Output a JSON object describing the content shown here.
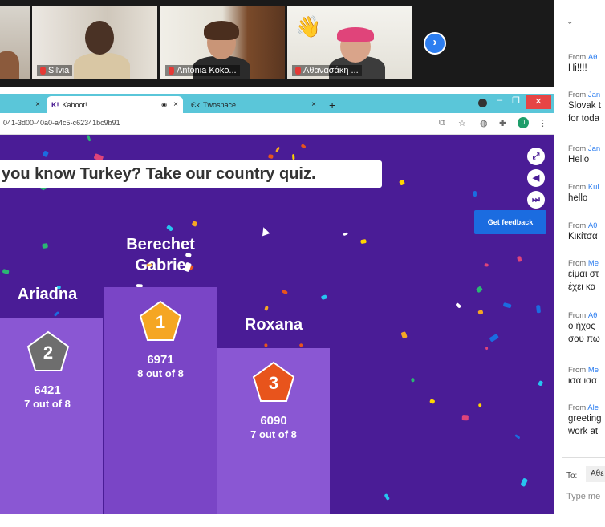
{
  "video_strip": {
    "participants": [
      {
        "name": ""
      },
      {
        "name": "Silvia"
      },
      {
        "name": "Antonia Koko..."
      },
      {
        "name": "Αθανασάκη ..."
      }
    ],
    "next_icon": "chevron-right-icon"
  },
  "browser": {
    "tabs": [
      {
        "label": "",
        "close": "×"
      },
      {
        "label": "Kahoot!",
        "close": "×",
        "favicon": "K!"
      },
      {
        "label": "Τwospace",
        "close": "×",
        "favicon": "Єk"
      }
    ],
    "new_tab": "+",
    "url": "041-3d00-40a0-a4c5-c62341bc9b91",
    "profile_initial": "0",
    "window_controls": {
      "minimize": "–",
      "restore": "❐",
      "close": "✕"
    }
  },
  "game": {
    "quiz_title": "you know Turkey? Take our country quiz.",
    "feedback_button": "Get feedback",
    "controls": [
      "fullscreen-icon",
      "volume-icon",
      "skip-icon"
    ],
    "podium": [
      {
        "place": "2",
        "name": "Ariadna",
        "score": "6421",
        "correct": "7 out of 8"
      },
      {
        "place": "1",
        "name": "Berechet Gabrie",
        "name_line1": "Berechet",
        "name_line2": "Gabrie",
        "score": "6971",
        "correct": "8 out of 8"
      },
      {
        "place": "3",
        "name": "Roxana",
        "score": "6090",
        "correct": "7 out of 8"
      }
    ],
    "colors": {
      "background": "#4a1c96",
      "podium": "#8a57d3",
      "first": "#f5a623",
      "second": "#6e6e6e",
      "third": "#e8541c"
    }
  },
  "chat": {
    "messages": [
      {
        "prefix": "From",
        "sender": "Αθ",
        "text": "Hi!!!!"
      },
      {
        "prefix": "From",
        "sender": "Jan",
        "text": "Slovak t",
        "text2": "for toda"
      },
      {
        "prefix": "From",
        "sender": "Jan",
        "text": "Hello"
      },
      {
        "prefix": "From",
        "sender": "Kul",
        "text": "hello"
      },
      {
        "prefix": "From",
        "sender": "Αθ",
        "text": "Κικίτσα"
      },
      {
        "prefix": "From",
        "sender": "Me",
        "text": "είμαι στ",
        "text2": "έχει κα"
      },
      {
        "prefix": "From",
        "sender": "Αθ",
        "text": "ο ήχος",
        "text2": "σου πω"
      },
      {
        "prefix": "From",
        "sender": "Me",
        "text": "ισα ισα"
      },
      {
        "prefix": "From",
        "sender": "Ale",
        "text": "greeting",
        "text2": "work at"
      }
    ],
    "to_label": "To:",
    "to_value": "Αθε",
    "input_placeholder": "Type me"
  }
}
